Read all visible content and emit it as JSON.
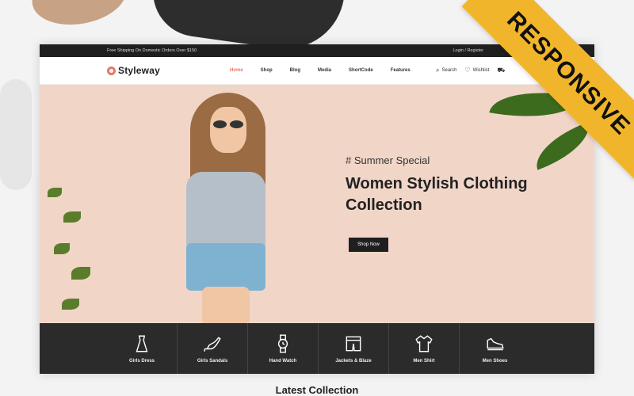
{
  "topbar": {
    "shipping_text": "Free Shipping On Domestic Orders Over $150",
    "login_text": "Login / Register"
  },
  "header": {
    "logo_text": "Styleway",
    "menu": [
      {
        "label": "Home",
        "active": true
      },
      {
        "label": "Shop"
      },
      {
        "label": "Blog"
      },
      {
        "label": "Media"
      },
      {
        "label": "ShortCode"
      },
      {
        "label": "Features"
      }
    ],
    "tools": {
      "search_label": "Search",
      "wishlist_label": "Wishlist"
    }
  },
  "hero": {
    "tag": "# Summer Special",
    "headline": "Women Stylish Clothing Collection",
    "cta_label": "Shop Now"
  },
  "categories": [
    {
      "label": "Girls Dress",
      "icon": "dress-icon"
    },
    {
      "label": "Girls Sandals",
      "icon": "heel-icon"
    },
    {
      "label": "Hand Watch",
      "icon": "watch-icon"
    },
    {
      "label": "Jackets & Blaze",
      "icon": "shorts-icon"
    },
    {
      "label": "Men Shirt",
      "icon": "shirt-icon"
    },
    {
      "label": "Men Shoes",
      "icon": "shoe-icon"
    }
  ],
  "section": {
    "latest_title": "Latest Collection"
  },
  "badge": {
    "text": "RESPONSIVE"
  },
  "colors": {
    "accent": "#e07b67",
    "dark": "#1f1f1f",
    "hero_bg": "#f1d6c8",
    "ribbon": "#f1b52c"
  }
}
